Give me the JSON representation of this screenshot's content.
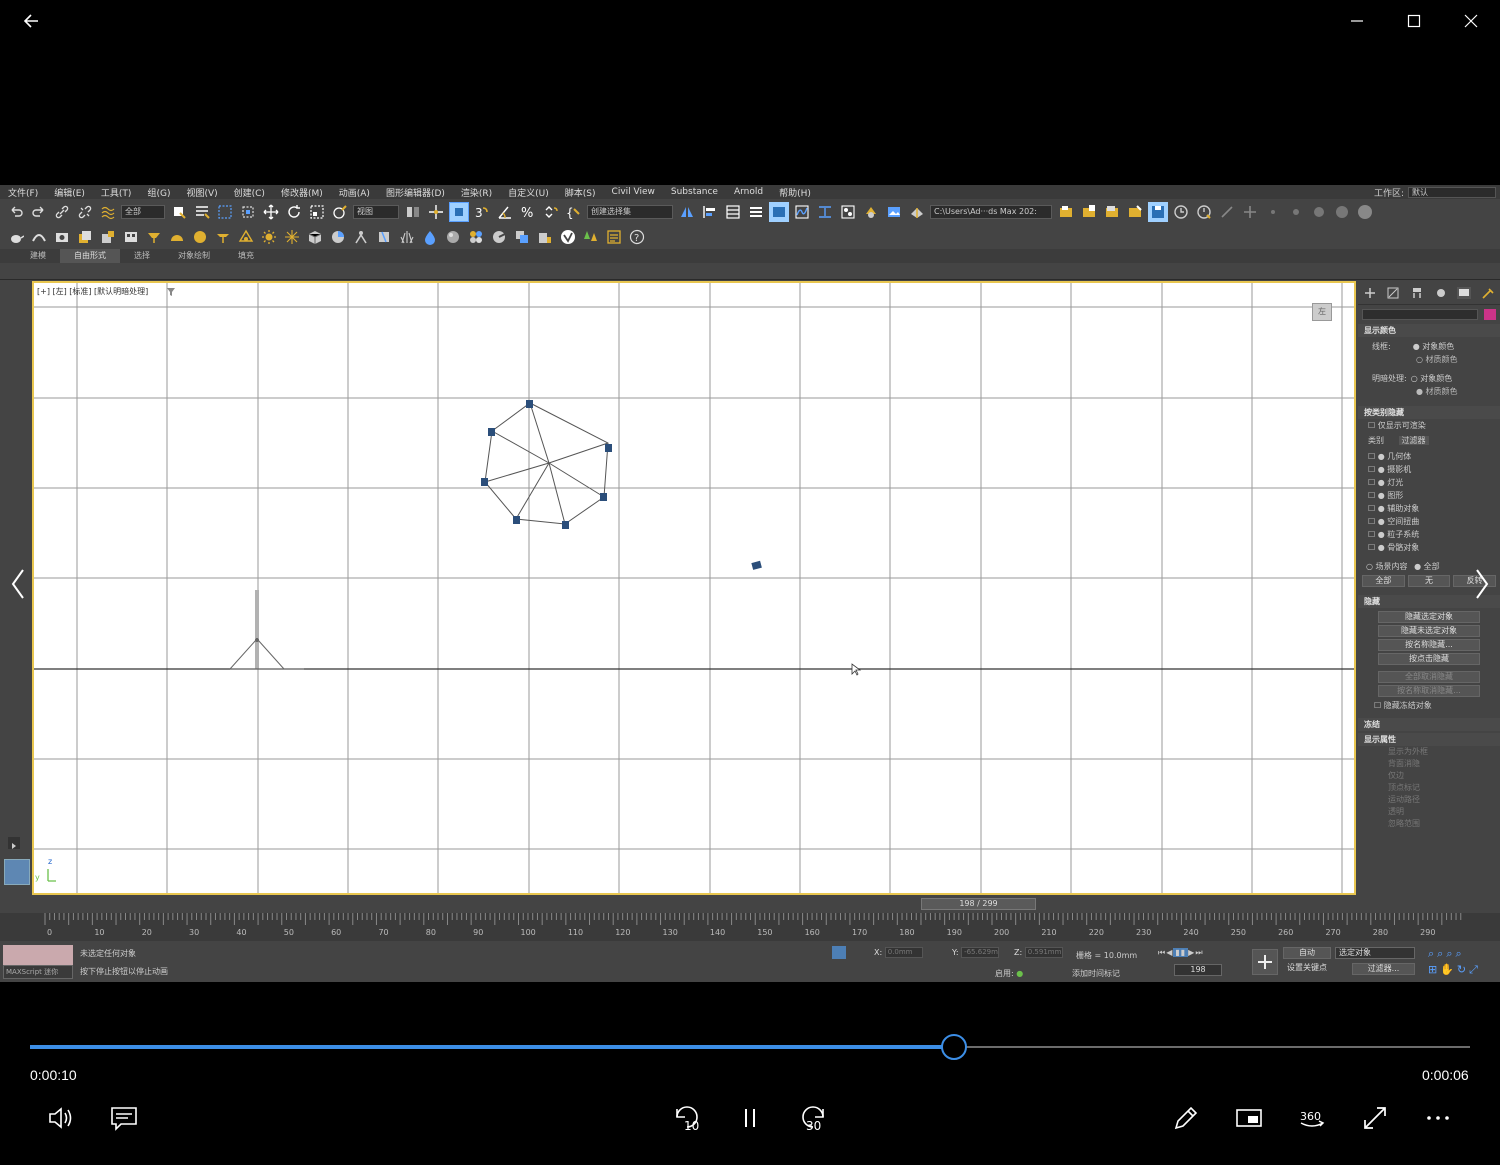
{
  "menu": [
    "文件(F)",
    "编辑(E)",
    "工具(T)",
    "组(G)",
    "视图(V)",
    "创建(C)",
    "修改器(M)",
    "动画(A)",
    "图形编辑器(D)",
    "渲染(R)",
    "自定义(U)",
    "脚本(S)",
    "Civil View",
    "Substance",
    "Arnold",
    "帮助(H)"
  ],
  "workspace": {
    "label": "工作区:",
    "value": "默认"
  },
  "toolbar": {
    "filter_select": "全部",
    "view_select": "视图",
    "selection_set": "创建选择集",
    "project_path": "C:\\Users\\Ad···ds Max 202:"
  },
  "ribbon_tabs": [
    "建模",
    "自由形式",
    "选择",
    "对象绘制",
    "填充"
  ],
  "ribbon_active": 1,
  "viewport": {
    "label": "[+] [左] [标准] [默认明暗处理]",
    "cube_label": "左",
    "axis_z": "z",
    "axis_y": "y"
  },
  "command_panel": {
    "display_color_title": "显示颜色",
    "wireframe_label": "线框:",
    "object_color": "对象颜色",
    "material_color": "材质颜色",
    "shaded_label": "明暗处理:",
    "object_color2": "对象颜色",
    "material_color2": "材质颜色",
    "hide_by_category_title": "按类别隐藏",
    "renderable_only": "仅显示可渲染",
    "tab_category": "类别",
    "tab_filter": "过滤器",
    "categories": [
      "几何体",
      "摄影机",
      "灯光",
      "图形",
      "辅助对象",
      "空间扭曲",
      "粒子系统",
      "骨骼对象"
    ],
    "scene_content": "场景内容",
    "all": "全部",
    "btn_all": "全部",
    "btn_none": "无",
    "btn_invert": "反转",
    "hide_title": "隐藏",
    "hide_buttons": [
      "隐藏选定对象",
      "隐藏未选定对象",
      "按名称隐藏...",
      "按点击隐藏"
    ],
    "unhide_buttons": [
      "全部取消隐藏",
      "按名称取消隐藏..."
    ],
    "hide_frozen": "隐藏冻结对象",
    "freeze_title": "冻结",
    "display_props_title": "显示属性",
    "display_props": [
      "显示为外框",
      "背面消隐",
      "仅边",
      "顶点标记",
      "运动路径",
      "透明",
      "忽略范围"
    ]
  },
  "timeline": {
    "frame_indicator": "198 / 299",
    "ticks": [
      "0",
      "10",
      "20",
      "30",
      "40",
      "50",
      "60",
      "70",
      "80",
      "90",
      "100",
      "110",
      "120",
      "130",
      "140",
      "150",
      "160",
      "170",
      "180",
      "190",
      "200",
      "210",
      "220",
      "230",
      "240",
      "250",
      "260",
      "270",
      "280",
      "290"
    ]
  },
  "status": {
    "maxscript": "MAXScript 迷你",
    "line1": "未选定任何对象",
    "line2": "按下停止按钮以停止动画",
    "x_label": "X:",
    "x_value": "0.0mm",
    "y_label": "Y:",
    "y_value": "-65.629m",
    "z_label": "Z:",
    "z_value": "0.591mm",
    "grid": "栅格 = 10.0mm",
    "enabled": "启用:",
    "add_time_tag": "添加时间标记",
    "auto_key": "自动",
    "selected_objects": "选定对象",
    "set_key": "设置关键点",
    "key_filters": "过滤器...",
    "frame": "198"
  },
  "player": {
    "time_elapsed": "0:00:10",
    "time_remaining": "0:00:06",
    "progress": 0.642,
    "accent": "#3c8ee6",
    "skip_back": "10",
    "skip_fwd": "30",
    "vr_label": "360"
  }
}
